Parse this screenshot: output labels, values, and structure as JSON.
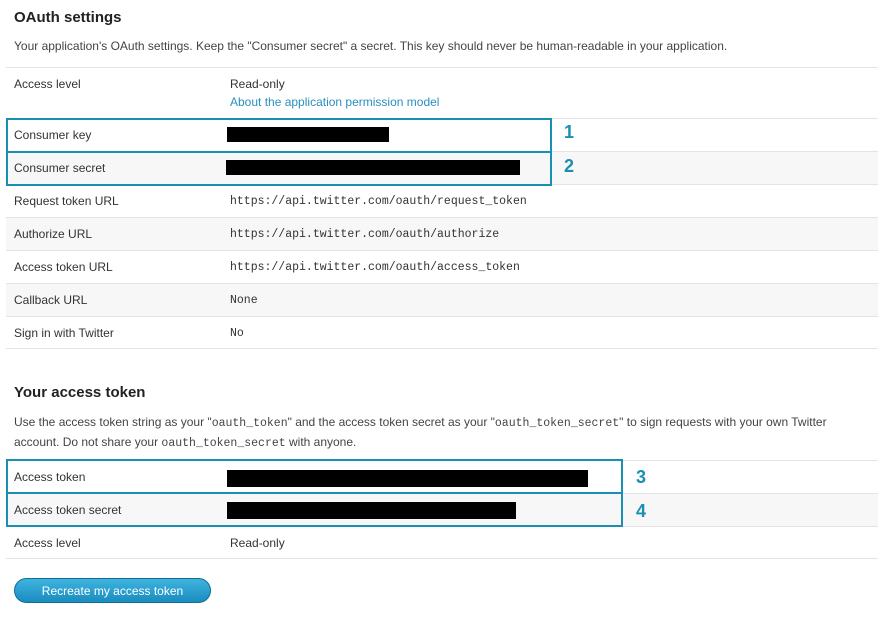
{
  "oauth": {
    "title": "OAuth settings",
    "description": "Your application's OAuth settings. Keep the \"Consumer secret\" a secret. This key should never be human-readable in your application.",
    "access_level_label": "Access level",
    "access_level_value": "Read-only",
    "permission_link": "About the application permission model",
    "consumer_key_label": "Consumer key",
    "consumer_secret_label": "Consumer secret",
    "request_token_label": "Request token URL",
    "request_token_value": "https://api.twitter.com/oauth/request_token",
    "authorize_label": "Authorize URL",
    "authorize_value": "https://api.twitter.com/oauth/authorize",
    "access_token_url_label": "Access token URL",
    "access_token_url_value": "https://api.twitter.com/oauth/access_token",
    "callback_label": "Callback URL",
    "callback_value": "None",
    "signin_label": "Sign in with Twitter",
    "signin_value": "No"
  },
  "token": {
    "title": "Your access token",
    "desc_1": "Use the access token string as your \"",
    "desc_code_1": "oauth_token",
    "desc_2": "\" and the access token secret as your \"",
    "desc_code_2": "oauth_token_secret",
    "desc_3": "\" to sign requests with your own Twitter",
    "desc_4": "account. Do not share your ",
    "desc_code_3": "oauth_token_secret",
    "desc_5": " with anyone.",
    "access_token_label": "Access token",
    "access_token_secret_label": "Access token secret",
    "access_level_label": "Access level",
    "access_level_value": "Read-only",
    "recreate_button": "Recreate my access token"
  },
  "annotations": [
    "1",
    "2",
    "3",
    "4"
  ],
  "colors": {
    "annotation": "#1b8fb3",
    "link": "#2a8fbd",
    "button": "#1a8cc0"
  }
}
